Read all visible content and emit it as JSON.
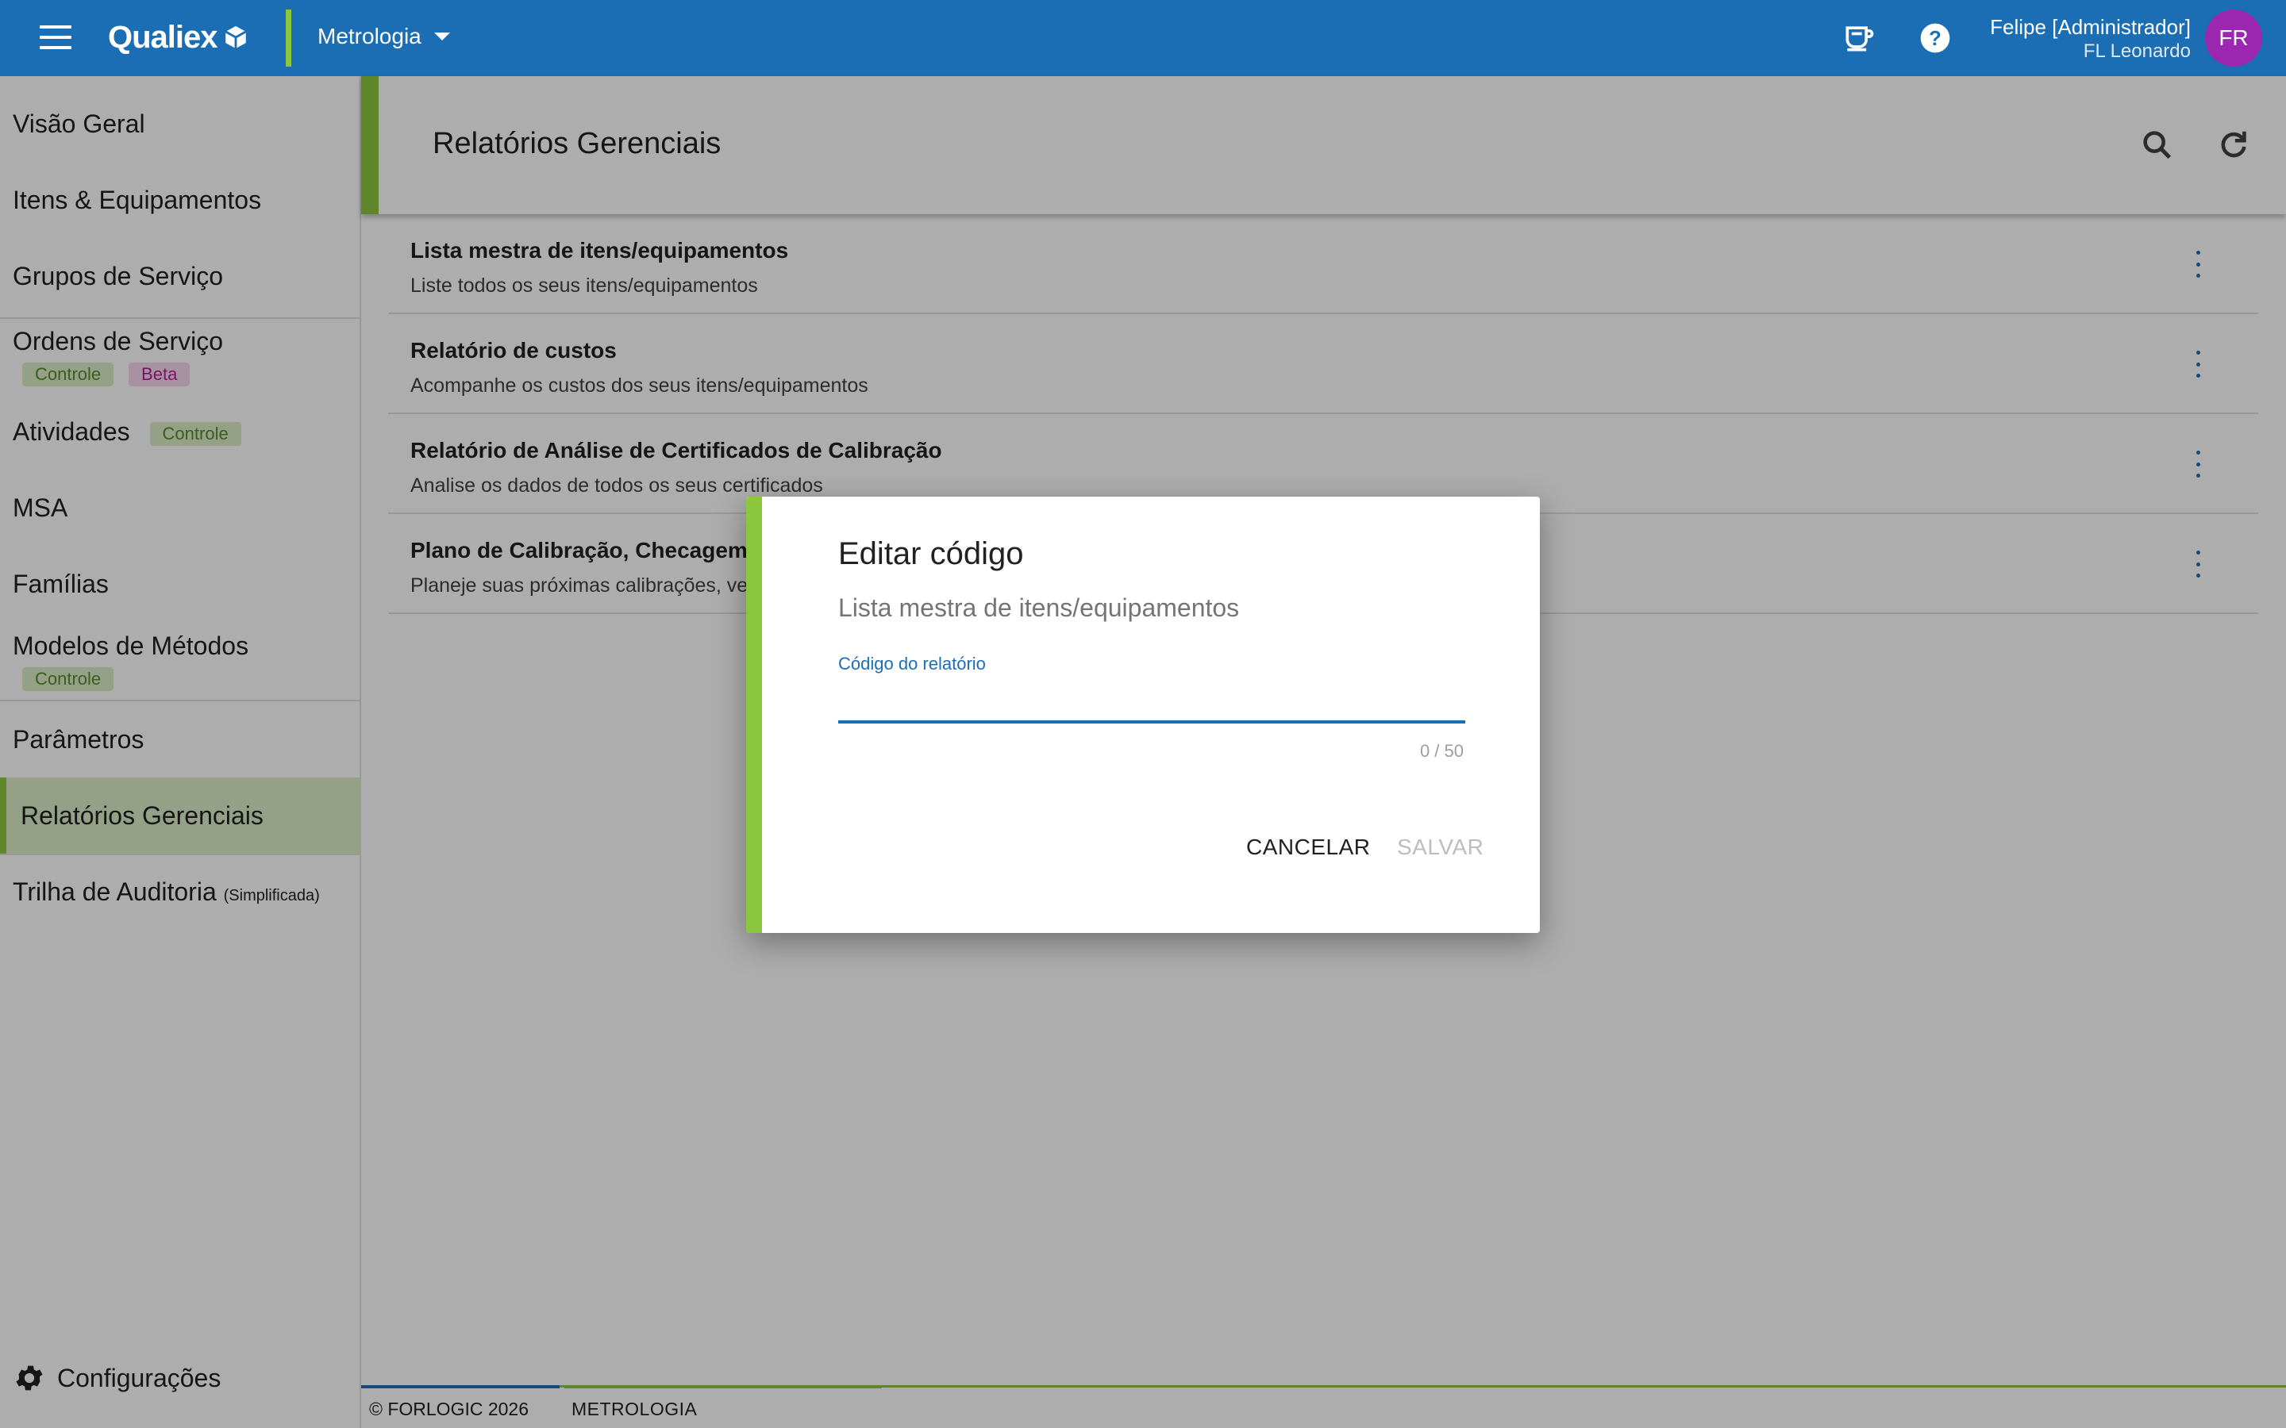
{
  "topbar": {
    "logo_text": "Qualiex",
    "module": "Metrologia",
    "user_name": "Felipe [Administrador]",
    "user_org": "FL Leonardo",
    "avatar_initials": "FR",
    "colors": {
      "bar": "#1c6eb4",
      "accent": "#8cc63f",
      "avatar": "#9c27b0"
    }
  },
  "sidebar": {
    "items": [
      {
        "label": "Visão Geral"
      },
      {
        "label": "Itens & Equipamentos"
      },
      {
        "label": "Grupos de Serviço"
      },
      {
        "label": "Ordens de Serviço",
        "badges": [
          "Controle",
          "Beta"
        ]
      },
      {
        "label": "Atividades",
        "badges": [
          "Controle"
        ]
      },
      {
        "label": "MSA"
      },
      {
        "label": "Famílias"
      },
      {
        "label": "Modelos de Métodos",
        "badges": [
          "Controle"
        ]
      },
      {
        "label": "Parâmetros"
      },
      {
        "label": "Relatórios Gerenciais",
        "active": true
      },
      {
        "label": "Trilha de Auditoria",
        "note": "(Simplificada)"
      }
    ],
    "settings_label": "Configurações"
  },
  "main": {
    "title": "Relatórios Gerenciais",
    "reports": [
      {
        "title": "Lista mestra de itens/equipamentos",
        "desc": "Liste todos os seus itens/equipamentos"
      },
      {
        "title": "Relatório de custos",
        "desc": "Acompanhe os custos dos seus itens/equipamentos"
      },
      {
        "title": "Relatório de Análise de Certificados de Calibração",
        "desc": "Analise os dados de todos os seus certificados"
      },
      {
        "title": "Plano de Calibração, Checagem e",
        "desc": "Planeje suas próximas calibrações, veri"
      }
    ]
  },
  "footer": {
    "copyright": "© FORLOGIC 2026",
    "module": "METROLOGIA"
  },
  "dialog": {
    "title": "Editar código",
    "subtitle": "Lista mestra de itens/equipamentos",
    "field_label": "Código do relatório",
    "field_value": "",
    "counter": "0 / 50",
    "cancel_label": "CANCELAR",
    "save_label": "SALVAR"
  }
}
